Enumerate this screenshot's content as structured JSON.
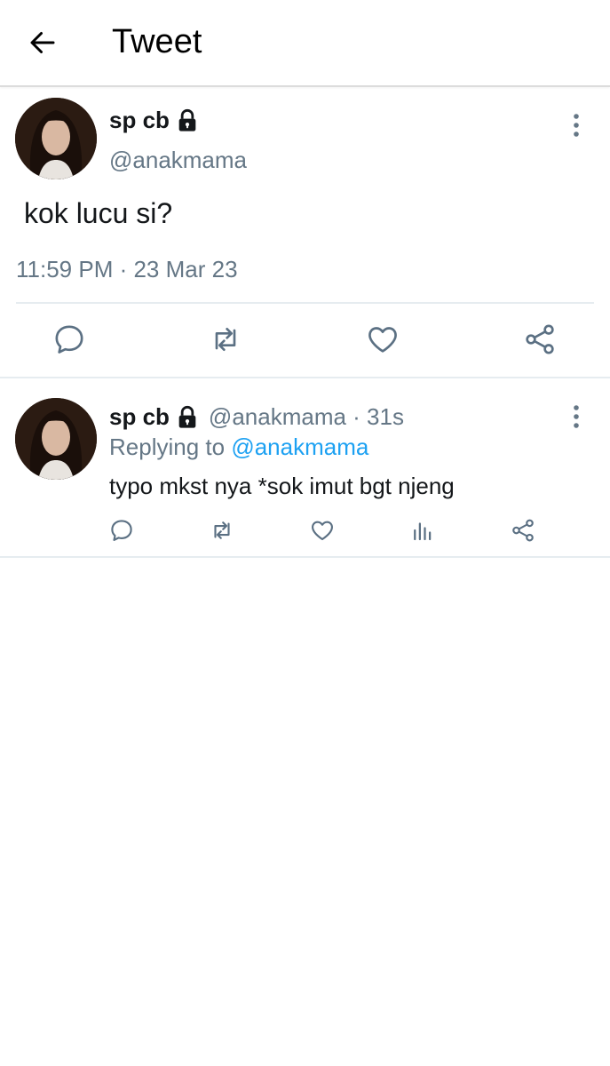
{
  "header": {
    "title": "Tweet"
  },
  "main_tweet": {
    "display_name": "sp cb",
    "handle": "@anakmama",
    "text": "kok lucu si?",
    "timestamp": "11:59 PM · 23 Mar 23"
  },
  "reply_tweet": {
    "display_name": "sp cb",
    "meta": "@anakmama · 31s",
    "replying_prefix": "Replying to ",
    "replying_to": "@anakmama",
    "text": "typo mkst nya *sok imut bgt njeng"
  },
  "colors": {
    "secondary_text": "#657786",
    "link": "#1da1f2",
    "icon": "#5b7083"
  },
  "icons": [
    "back-arrow-icon",
    "lock-icon",
    "more-vertical-icon",
    "reply-icon",
    "retweet-icon",
    "like-icon",
    "share-icon",
    "analytics-icon"
  ]
}
